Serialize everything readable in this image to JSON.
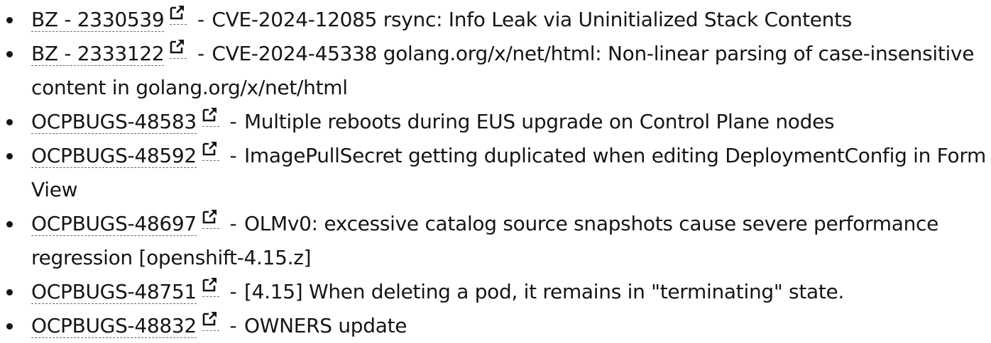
{
  "items": [
    {
      "id": "BZ - 2330539",
      "separator": " - ",
      "description": "CVE-2024-12085 rsync: Info Leak via Uninitialized Stack Contents"
    },
    {
      "id": "BZ - 2333122",
      "separator": " - ",
      "description": "CVE-2024-45338 golang.org/x/net/html: Non-linear parsing of case-insensitive content in golang.org/x/net/html"
    },
    {
      "id": "OCPBUGS-48583",
      "separator": " - ",
      "description": "Multiple reboots during EUS upgrade on Control Plane nodes"
    },
    {
      "id": "OCPBUGS-48592",
      "separator": " - ",
      "description": "ImagePullSecret getting duplicated when editing DeploymentConfig in Form View"
    },
    {
      "id": "OCPBUGS-48697",
      "separator": " - ",
      "description": "OLMv0: excessive catalog source snapshots cause severe performance regression [openshift-4.15.z]"
    },
    {
      "id": "OCPBUGS-48751",
      "separator": " - ",
      "description": "[4.15] When deleting a pod, it remains in \"terminating\" state."
    },
    {
      "id": "OCPBUGS-48832",
      "separator": " - ",
      "description": "OWNERS update"
    }
  ],
  "icons": {
    "external_link": "external-link-icon"
  }
}
